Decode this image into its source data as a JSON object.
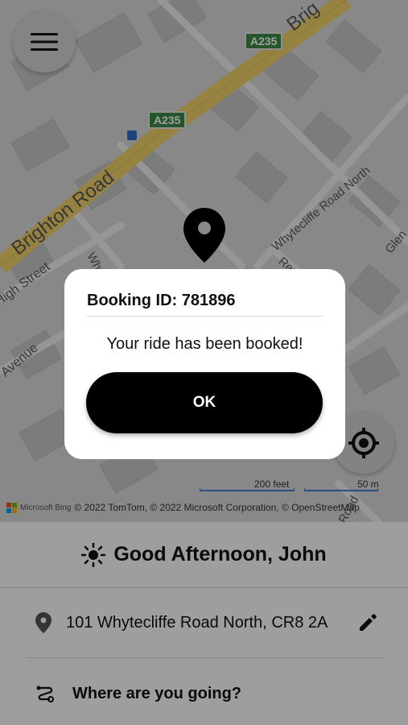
{
  "map": {
    "roads": {
      "brighton": "Brighton Road",
      "brighton_top": "Brig",
      "high_street": "High Street",
      "whytecliffe_north": "Whytecliffe Road North",
      "avenue": "Avenue",
      "whyte_short": "Why",
      "red_short": "Red",
      "glen_short": "Glen",
      "road_short": "Road"
    },
    "shields": [
      "A235",
      "A235"
    ],
    "scale_feet": "200 feet",
    "scale_m": "50 m",
    "attribution_brand": "Microsoft Bing",
    "attribution": "© 2022 TomTom, © 2022 Microsoft Corporation, © OpenStreetMap"
  },
  "panel": {
    "greeting": "Good Afternoon, John",
    "pickup_address": "101 Whytecliffe Road North, CR8 2A",
    "destination_placeholder": "Where are you going?"
  },
  "dialog": {
    "title": "Booking ID: 781896",
    "message": "Your ride has been booked!",
    "ok_label": "OK"
  },
  "colors": {
    "major_road": "#f2d36b",
    "shield": "#3c8b46",
    "scale": "#4a7bd0",
    "button": "#000000"
  },
  "icons": [
    "menu-icon",
    "locate-icon",
    "map-pin-icon",
    "sun-icon",
    "location-icon",
    "edit-icon",
    "route-icon"
  ]
}
